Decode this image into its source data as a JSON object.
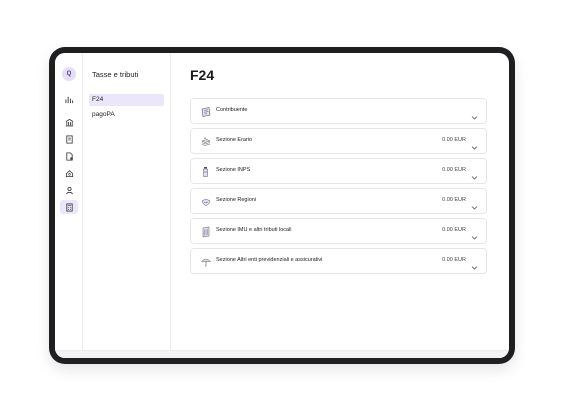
{
  "app": {
    "avatar_initial": "Q",
    "accent": "#ece6fb",
    "frame": "#1f1f21"
  },
  "rail": {
    "icons": [
      "chart-icon",
      "bank-icon",
      "ledger-icon",
      "document-icon",
      "house-icon",
      "person-icon",
      "calculator-icon"
    ],
    "active": "calculator-icon"
  },
  "sidebar": {
    "title": "Tasse e tributi",
    "items": [
      {
        "label": "F24",
        "active": true
      },
      {
        "label": "pagoPA",
        "active": false
      }
    ]
  },
  "main": {
    "title": "F24",
    "sections": [
      {
        "label": "Contribuente",
        "amount": "",
        "icon": "contributor-card-icon"
      },
      {
        "label": "Sezione Erario",
        "amount": "0.00 EUR",
        "icon": "erario-stack-icon"
      },
      {
        "label": "Sezione INPS",
        "amount": "0.00 EUR",
        "icon": "inps-bottle-icon"
      },
      {
        "label": "Sezione Regioni",
        "amount": "0.00 EUR",
        "icon": "regioni-map-icon"
      },
      {
        "label": "Sezione IMU e altri tributi locali",
        "amount": "0.00 EUR",
        "icon": "imu-building-icon"
      },
      {
        "label": "Sezione Altri enti previdenziali e assicurativi",
        "amount": "0.00 EUR",
        "icon": "umbrella-icon"
      }
    ]
  }
}
